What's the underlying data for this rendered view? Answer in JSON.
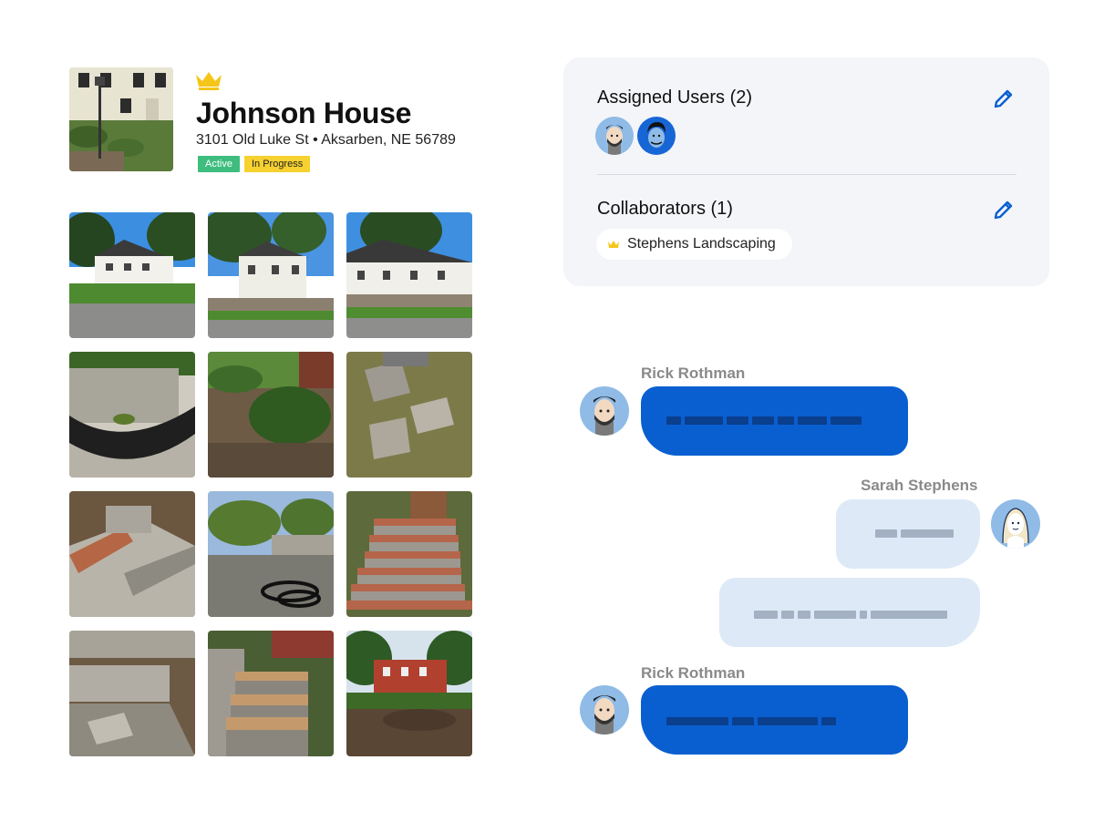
{
  "project": {
    "title": "Johnson House",
    "address": "3101 Old Luke St • Aksarben, NE 56789",
    "status_badges": [
      "Active",
      "In Progress"
    ],
    "crown_icon": "crown-icon"
  },
  "colors": {
    "primary_blue": "#0a5fd0",
    "light_bubble": "#dde9f7",
    "badge_active": "#3ebd7f",
    "badge_progress": "#f6d130",
    "crown": "#f5c518",
    "card_bg": "#f3f5f8"
  },
  "team": {
    "assigned_title": "Assigned Users (2)",
    "collaborators_title": "Collaborators (1)",
    "collaborator_name": "Stephens Landscaping",
    "edit_icon": "pencil-icon"
  },
  "messages": {
    "sender1": "Rick Rothman",
    "sender2": "Sarah Stephens",
    "sender3": "Rick Rothman"
  }
}
